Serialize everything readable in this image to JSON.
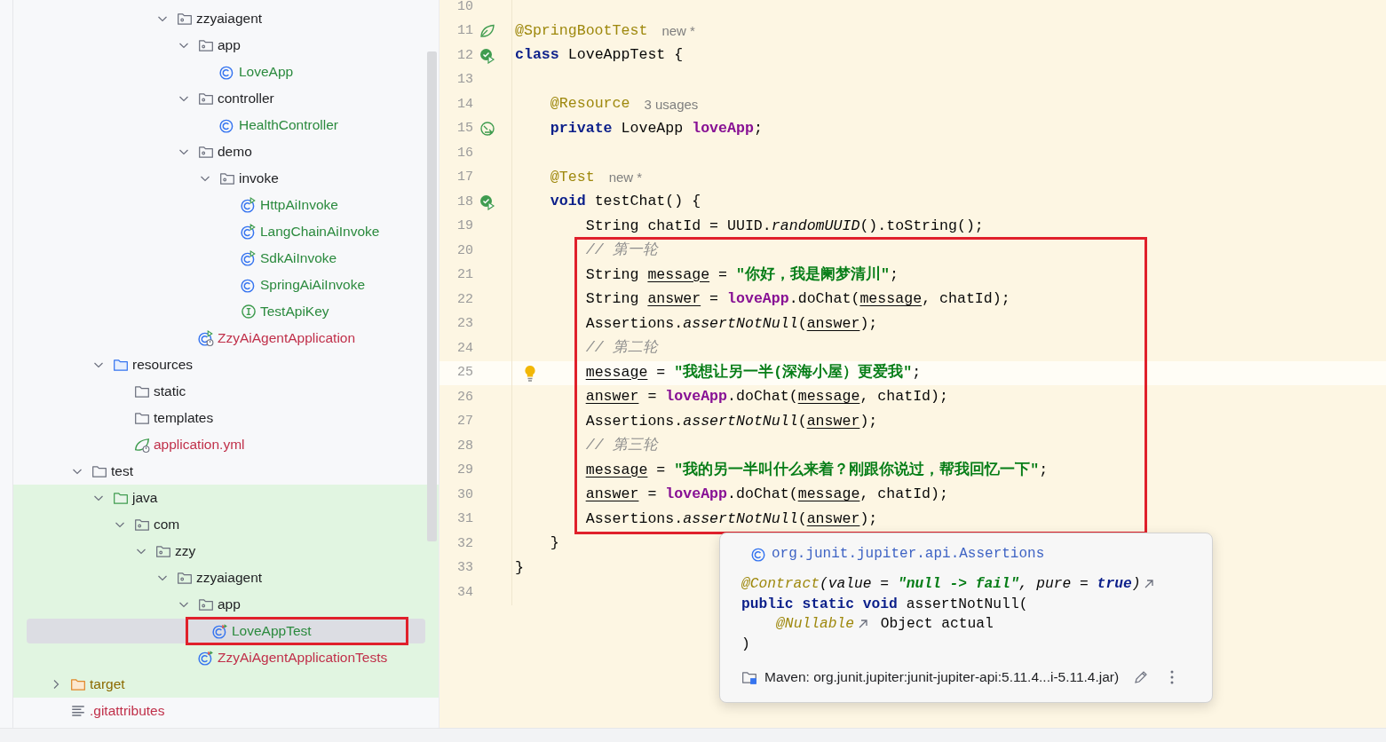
{
  "project_tree": {
    "items": [
      {
        "children": [
          {
            "children": [
              {
                "children": [
                  {
                    "children": [
                      {
                        "children": [
                          {
                            "label": "zzyaiagent",
                            "kind": "package",
                            "color": "#1e1f22",
                            "expanded": true,
                            "selected": false,
                            "tinted": false,
                            "annotated": false,
                            "children": [
                              {
                                "label": "app",
                                "kind": "package",
                                "color": "#1e1f22",
                                "expanded": true,
                                "selected": false,
                                "tinted": false,
                                "annotated": false,
                                "children": [
                                  {
                                    "label": "LoveApp",
                                    "kind": "class",
                                    "color": "#2b8a3e",
                                    "selected": false,
                                    "tinted": false,
                                    "annotated": false
                                  }
                                ]
                              },
                              {
                                "label": "controller",
                                "kind": "package",
                                "color": "#1e1f22",
                                "expanded": true,
                                "selected": false,
                                "tinted": false,
                                "annotated": false,
                                "children": [
                                  {
                                    "label": "HealthController",
                                    "kind": "class",
                                    "color": "#2b8a3e",
                                    "selected": false,
                                    "tinted": false,
                                    "annotated": false
                                  }
                                ]
                              },
                              {
                                "label": "demo",
                                "kind": "package",
                                "color": "#1e1f22",
                                "expanded": true,
                                "selected": false,
                                "tinted": false,
                                "annotated": false,
                                "children": [
                                  {
                                    "label": "invoke",
                                    "kind": "package",
                                    "color": "#1e1f22",
                                    "expanded": true,
                                    "selected": false,
                                    "tinted": false,
                                    "annotated": false,
                                    "children": [
                                      {
                                        "label": "HttpAiInvoke",
                                        "kind": "runnable-class",
                                        "color": "#2b8a3e",
                                        "selected": false,
                                        "tinted": false,
                                        "annotated": false
                                      },
                                      {
                                        "label": "LangChainAiInvoke",
                                        "kind": "runnable-class",
                                        "color": "#2b8a3e",
                                        "selected": false,
                                        "tinted": false,
                                        "annotated": false
                                      },
                                      {
                                        "label": "SdkAiInvoke",
                                        "kind": "runnable-class",
                                        "color": "#2b8a3e",
                                        "selected": false,
                                        "tinted": false,
                                        "annotated": false
                                      },
                                      {
                                        "label": "SpringAiAiInvoke",
                                        "kind": "class",
                                        "color": "#2b8a3e",
                                        "selected": false,
                                        "tinted": false,
                                        "annotated": false
                                      },
                                      {
                                        "label": "TestApiKey",
                                        "kind": "interface",
                                        "color": "#2b8a3e",
                                        "selected": false,
                                        "tinted": false,
                                        "annotated": false
                                      }
                                    ]
                                  }
                                ]
                              },
                              {
                                "label": "ZzyAiAgentApplication",
                                "kind": "spring-app",
                                "color": "#c0304a",
                                "selected": false,
                                "tinted": false,
                                "annotated": false
                              }
                            ]
                          }
                        ]
                      }
                    ]
                  }
                ]
              },
              {
                "label": "resources",
                "kind": "resources-folder",
                "color": "#1e1f22",
                "expanded": true,
                "selected": false,
                "tinted": false,
                "annotated": false,
                "children": [
                  {
                    "label": "static",
                    "kind": "folder",
                    "color": "#1e1f22",
                    "selected": false,
                    "tinted": false,
                    "annotated": false
                  },
                  {
                    "label": "templates",
                    "kind": "folder",
                    "color": "#1e1f22",
                    "selected": false,
                    "tinted": false,
                    "annotated": false
                  },
                  {
                    "label": "application.yml",
                    "kind": "spring-config",
                    "color": "#c0304a",
                    "selected": false,
                    "tinted": false,
                    "annotated": false
                  }
                ]
              }
            ]
          },
          {
            "label": "test",
            "kind": "folder",
            "color": "#1e1f22",
            "expanded": true,
            "selected": false,
            "tinted": false,
            "annotated": false,
            "children": [
              {
                "label": "java",
                "kind": "test-folder",
                "color": "#1e1f22",
                "expanded": true,
                "selected": false,
                "tinted": true,
                "annotated": false,
                "children": [
                  {
                    "label": "com",
                    "kind": "package",
                    "color": "#1e1f22",
                    "expanded": true,
                    "selected": false,
                    "tinted": true,
                    "annotated": false,
                    "children": [
                      {
                        "label": "zzy",
                        "kind": "package",
                        "color": "#1e1f22",
                        "expanded": true,
                        "selected": false,
                        "tinted": true,
                        "annotated": false,
                        "children": [
                          {
                            "label": "zzyaiagent",
                            "kind": "package",
                            "color": "#1e1f22",
                            "expanded": true,
                            "selected": false,
                            "tinted": true,
                            "annotated": false,
                            "children": [
                              {
                                "label": "app",
                                "kind": "package",
                                "color": "#1e1f22",
                                "expanded": true,
                                "selected": false,
                                "tinted": true,
                                "annotated": false,
                                "children": [
                                  {
                                    "label": "LoveAppTest",
                                    "kind": "test-class",
                                    "color": "#2b8a3e",
                                    "selected": true,
                                    "tinted": true,
                                    "annotated": true
                                  }
                                ]
                              },
                              {
                                "label": "ZzyAiAgentApplicationTests",
                                "kind": "test-class",
                                "color": "#c0304a",
                                "selected": false,
                                "tinted": true,
                                "annotated": false
                              }
                            ]
                          }
                        ]
                      }
                    ]
                  }
                ]
              }
            ]
          }
        ]
      },
      {
        "label": "target",
        "kind": "excluded-folder",
        "color": "#8c6a00",
        "expanded": false,
        "selected": false,
        "tinted": true,
        "annotated": false
      },
      {
        "label": ".gitattributes",
        "kind": "text-file",
        "color": "#c0304a",
        "selected": false,
        "tinted": false,
        "annotated": false
      }
    ]
  },
  "editor": {
    "sections": [
      {
        "boxed": false,
        "lines": [
          {
            "number": "10",
            "current": false
          },
          {
            "number": "11",
            "gutter": {
              "kind": "spring"
            },
            "tokens": [
              {
                "text": "@SpringBootTest",
                "kind": "ann"
              },
              {
                "text": "new *",
                "kind": "hint"
              }
            ],
            "current": false
          },
          {
            "number": "12",
            "gutter": {
              "kind": "run"
            },
            "tokens": [
              {
                "text": "class",
                "kind": "kw"
              },
              {
                "text": " LoveAppTest {",
                "kind": "plain"
              }
            ],
            "current": false
          },
          {
            "number": "13",
            "current": false
          },
          {
            "number": "14",
            "tokens": [
              {
                "text": "    @Resource",
                "kind": "ann"
              },
              {
                "text": "3 usages",
                "kind": "hint"
              }
            ],
            "current": false
          },
          {
            "number": "15",
            "gutter": {
              "kind": "bean"
            },
            "tokens": [
              {
                "text": "    private",
                "kind": "kw"
              },
              {
                "text": " LoveApp ",
                "kind": "plain"
              },
              {
                "text": "loveApp",
                "kind": "field"
              },
              {
                "text": ";",
                "kind": "plain"
              }
            ],
            "current": false
          },
          {
            "number": "16",
            "current": false
          },
          {
            "number": "17",
            "tokens": [
              {
                "text": "    @Test",
                "kind": "ann"
              },
              {
                "text": "new *",
                "kind": "hint"
              }
            ],
            "current": false
          },
          {
            "number": "18",
            "gutter": {
              "kind": "run"
            },
            "tokens": [
              {
                "text": "    void",
                "kind": "kw"
              },
              {
                "text": " testChat() {",
                "kind": "plain"
              }
            ],
            "current": false
          },
          {
            "number": "19",
            "tokens": [
              {
                "text": "        String chatId = UUID.",
                "kind": "plain"
              },
              {
                "text": "randomUUID",
                "kind": "static"
              },
              {
                "text": "().toString();",
                "kind": "plain"
              }
            ],
            "current": false
          }
        ]
      },
      {
        "boxed": true,
        "lines": [
          {
            "number": "20",
            "tokens": [
              {
                "text": "        // 第一轮",
                "kind": "comment"
              }
            ],
            "current": false
          },
          {
            "number": "21",
            "tokens": [
              {
                "text": "        String ",
                "kind": "plain"
              },
              {
                "text": "message",
                "kind": "var"
              },
              {
                "text": " = ",
                "kind": "plain"
              },
              {
                "text": "\"你好，我是阑梦清川\"",
                "kind": "str"
              },
              {
                "text": ";",
                "kind": "plain"
              }
            ],
            "current": false
          },
          {
            "number": "22",
            "tokens": [
              {
                "text": "        String ",
                "kind": "plain"
              },
              {
                "text": "answer",
                "kind": "var"
              },
              {
                "text": " = ",
                "kind": "plain"
              },
              {
                "text": "loveApp",
                "kind": "field"
              },
              {
                "text": ".doChat(",
                "kind": "plain"
              },
              {
                "text": "message",
                "kind": "var"
              },
              {
                "text": ", chatId);",
                "kind": "plain"
              }
            ],
            "current": false
          },
          {
            "number": "23",
            "tokens": [
              {
                "text": "        Assertions.",
                "kind": "plain"
              },
              {
                "text": "assertNotNull",
                "kind": "static"
              },
              {
                "text": "(",
                "kind": "plain"
              },
              {
                "text": "answer",
                "kind": "var"
              },
              {
                "text": ");",
                "kind": "plain"
              }
            ],
            "current": false
          },
          {
            "number": "24",
            "tokens": [
              {
                "text": "        // 第二轮",
                "kind": "comment"
              }
            ],
            "current": false
          },
          {
            "number": "25",
            "gutter": {
              "kind": "bulb"
            },
            "tokens": [
              {
                "text": "        message",
                "kind": "var"
              },
              {
                "text": " = ",
                "kind": "plain"
              },
              {
                "text": "\"我想让另一半(深海小屋）更爱我\"",
                "kind": "str"
              },
              {
                "text": ";",
                "kind": "plain"
              }
            ],
            "current": true
          },
          {
            "number": "26",
            "tokens": [
              {
                "text": "        answer",
                "kind": "var"
              },
              {
                "text": " = ",
                "kind": "plain"
              },
              {
                "text": "loveApp",
                "kind": "field"
              },
              {
                "text": ".doChat(",
                "kind": "plain"
              },
              {
                "text": "message",
                "kind": "var"
              },
              {
                "text": ", chatId);",
                "kind": "plain"
              }
            ],
            "current": false
          },
          {
            "number": "27",
            "tokens": [
              {
                "text": "        Assertions.",
                "kind": "plain"
              },
              {
                "text": "assertNotNull",
                "kind": "static"
              },
              {
                "text": "(",
                "kind": "plain"
              },
              {
                "text": "answer",
                "kind": "var"
              },
              {
                "text": ");",
                "kind": "plain"
              }
            ],
            "current": false
          },
          {
            "number": "28",
            "tokens": [
              {
                "text": "        // 第三轮",
                "kind": "comment"
              }
            ],
            "current": false
          },
          {
            "number": "29",
            "tokens": [
              {
                "text": "        message",
                "kind": "var"
              },
              {
                "text": " = ",
                "kind": "plain"
              },
              {
                "text": "\"我的另一半叫什么来着？刚跟你说过，帮我回忆一下\"",
                "kind": "str"
              },
              {
                "text": ";",
                "kind": "plain"
              }
            ],
            "current": false
          },
          {
            "number": "30",
            "tokens": [
              {
                "text": "        answer",
                "kind": "var"
              },
              {
                "text": " = ",
                "kind": "plain"
              },
              {
                "text": "loveApp",
                "kind": "field"
              },
              {
                "text": ".doChat(",
                "kind": "plain"
              },
              {
                "text": "message",
                "kind": "var"
              },
              {
                "text": ", chatId);",
                "kind": "plain"
              }
            ],
            "current": false
          },
          {
            "number": "31",
            "tokens": [
              {
                "text": "        Assertions.",
                "kind": "plain"
              },
              {
                "text": "assertNotNull",
                "kind": "static"
              },
              {
                "text": "(",
                "kind": "plain"
              },
              {
                "text": "answer",
                "kind": "var"
              },
              {
                "text": ");",
                "kind": "plain"
              }
            ],
            "current": false
          }
        ]
      },
      {
        "boxed": false,
        "lines": [
          {
            "number": "32",
            "tokens": [
              {
                "text": "    }",
                "kind": "plain"
              }
            ],
            "current": false
          },
          {
            "number": "33",
            "tokens": [
              {
                "text": "}",
                "kind": "plain"
              }
            ],
            "current": false
          },
          {
            "number": "34",
            "current": false
          }
        ]
      }
    ]
  },
  "doc_popup": {
    "title": "org.junit.jupiter.api.Assertions",
    "signature": [
      [
        {
          "text": "@Contract",
          "kind": "ann-i"
        },
        {
          "text": "(value = ",
          "kind": "italic"
        },
        {
          "text": "\"null -> fail\"",
          "kind": "str-i"
        },
        {
          "text": ", pure = ",
          "kind": "italic"
        },
        {
          "text": "true",
          "kind": "kw-i"
        },
        {
          "text": ")",
          "kind": "italic"
        },
        {
          "kind": "ext"
        }
      ],
      [
        {
          "text": "public static void",
          "kind": "kw"
        },
        {
          "text": " assertNotNull(",
          "kind": "plain"
        }
      ],
      [
        {
          "text": "    @Nullable",
          "kind": "ann-i"
        },
        {
          "kind": "ext"
        },
        {
          "text": " Object actual",
          "kind": "plain"
        }
      ],
      [
        {
          "text": ")",
          "kind": "plain"
        }
      ]
    ],
    "source": "Maven: org.junit.jupiter:junit-jupiter-api:5.11.4...i-5.11.4.jar)"
  }
}
